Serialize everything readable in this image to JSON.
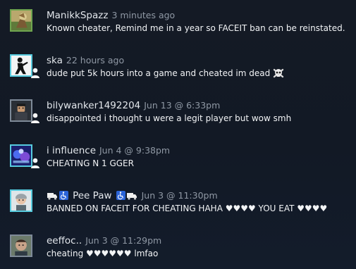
{
  "comments": [
    {
      "author": "ManikkSpazz",
      "time": "3 minutes ago",
      "text": "Known cheater, Remind me in a year so FACEIT ban can be reinstated."
    },
    {
      "author": "ska",
      "time": "22 hours ago",
      "text": "dude put 5k hours into a game and cheated im dead",
      "emoji": "skull-crossbones-icon"
    },
    {
      "author": "bilywanker1492204",
      "time": "Jun 13 @ 6:33pm",
      "text": "disappointed i thought u were a legit player but wow smh"
    },
    {
      "author": "i influence",
      "time": "Jun 4 @ 9:38pm",
      "text": "CHEATING N 1 GGER"
    },
    {
      "author": "Pee Paw",
      "time": "Jun 3 @ 11:30pm",
      "text": "BANNED ON FACEIT FOR CHEATING HAHA ♥♥♥♥ YOU EAT ♥♥♥♥"
    },
    {
      "author": "eeffoc..",
      "time": "Jun 3 @ 11:29pm",
      "text": "cheating ♥♥♥♥♥♥ lmfao"
    }
  ],
  "colors": {
    "online_border": "#57cbde",
    "offline_border": "#7e8a98",
    "ingame_border": "#6fa54f",
    "background": "#131a26"
  }
}
